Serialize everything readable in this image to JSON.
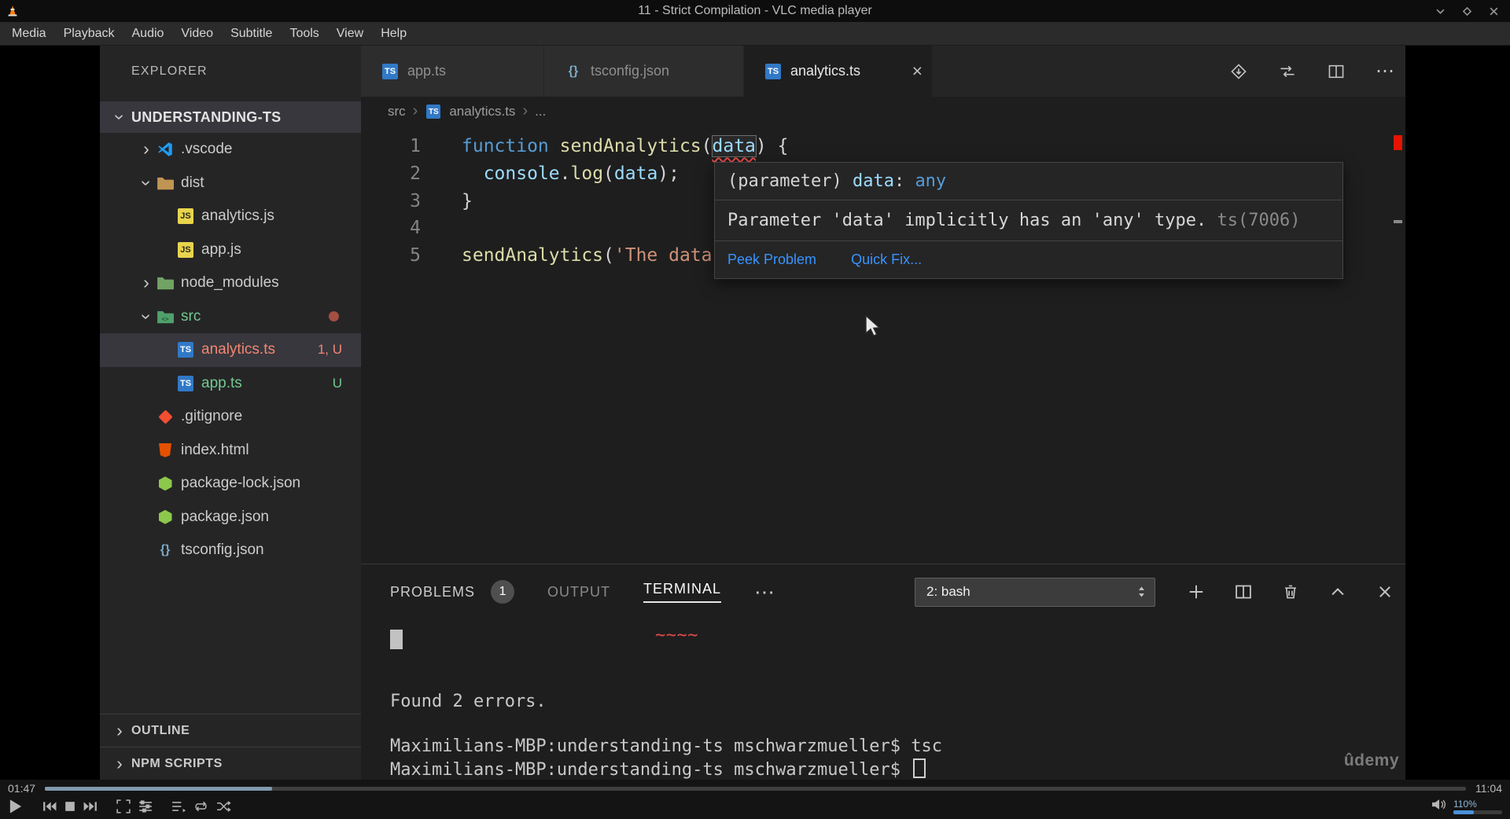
{
  "window": {
    "title": "11 - Strict Compilation - VLC media player"
  },
  "menu": {
    "items": [
      "Media",
      "Playback",
      "Audio",
      "Video",
      "Subtitle",
      "Tools",
      "View",
      "Help"
    ]
  },
  "glyphs": {
    "chev_right": "›",
    "more_h": "⋯",
    "close": "×"
  },
  "explorer": {
    "header": "EXPLORER",
    "root": "UNDERSTANDING-TS",
    "items": [
      {
        "label": ".vscode"
      },
      {
        "label": "dist"
      },
      {
        "label": "analytics.js"
      },
      {
        "label": "app.js"
      },
      {
        "label": "node_modules"
      },
      {
        "label": "src"
      },
      {
        "label": "analytics.ts",
        "badge": "1, U"
      },
      {
        "label": "app.ts",
        "badge": "U"
      },
      {
        "label": ".gitignore"
      },
      {
        "label": "index.html"
      },
      {
        "label": "package-lock.json"
      },
      {
        "label": "package.json"
      },
      {
        "label": "tsconfig.json"
      }
    ],
    "sections": [
      {
        "label": "OUTLINE"
      },
      {
        "label": "NPM SCRIPTS"
      }
    ]
  },
  "tabs": [
    {
      "label": "app.ts"
    },
    {
      "label": "tsconfig.json"
    },
    {
      "label": "analytics.ts"
    }
  ],
  "breadcrumb": {
    "dir": "src",
    "file": "analytics.ts",
    "more": "..."
  },
  "code": {
    "l1": {
      "n": "1",
      "kw": "function ",
      "fn": "sendAnalytics",
      "p1": "(",
      "param": "data",
      "p2": ") {"
    },
    "l2": {
      "n": "2",
      "ind": "  ",
      "obj": "console",
      "dot": ".",
      "fn": "log",
      "p1": "(",
      "arg": "data",
      "p2": ");"
    },
    "l3": {
      "n": "3",
      "txt": "}"
    },
    "l4": {
      "n": "4"
    },
    "l5": {
      "n": "5",
      "fn": "sendAnalytics",
      "p1": "(",
      "str": "'The data"
    }
  },
  "hover": {
    "sig_pre": "(parameter) ",
    "sig_name": "data",
    "sig_sep": ": ",
    "sig_type": "any",
    "message": "Parameter 'data' implicitly has an 'any' type. ",
    "err_code": "ts(7006)",
    "peek": "Peek Problem",
    "quick_fix": "Quick Fix..."
  },
  "panel": {
    "problems": "PROBLEMS",
    "problems_badge": "1",
    "output": "OUTPUT",
    "terminal": "TERMINAL",
    "shell": "2: bash",
    "term": {
      "squiggle": "~~~~",
      "summary": "Found 2 errors.",
      "line1": "Maximilians-MBP:understanding-ts mschwarzmueller$ tsc",
      "line2": "Maximilians-MBP:understanding-ts mschwarzmueller$"
    }
  },
  "watermark": "ûdemy",
  "player": {
    "time_current": "01:47",
    "time_total": "11:04",
    "progress_pct": 16,
    "volume_label": "110%",
    "volume_pct": 42
  }
}
